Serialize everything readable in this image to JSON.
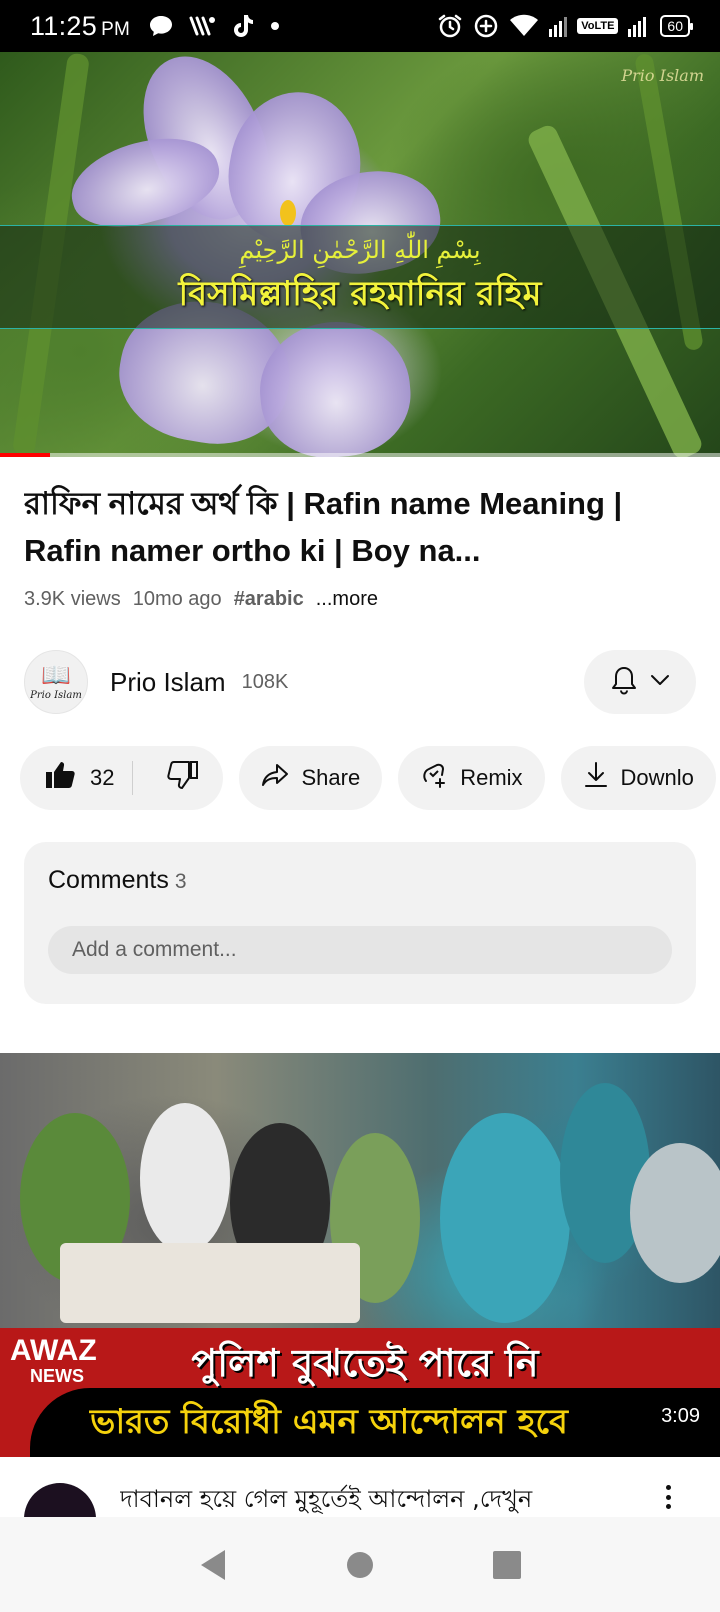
{
  "status_bar": {
    "time": "11:25",
    "ampm": "PM",
    "volte": "VoLTE",
    "battery": "60",
    "icons": [
      "chat-bubble-icon",
      "wifi-calling-icon",
      "tiktok-icon",
      "dot-icon",
      "alarm-icon",
      "data-saver-icon",
      "wifi-icon",
      "signal-icon",
      "signal-icon-2",
      "battery-icon"
    ]
  },
  "player": {
    "arabic_text": "بِسْمِ اللّٰهِ الرَّحْمٰنِ الرَّحِيْمِ",
    "bengali_text": "বিসমিল্লাহির রহমানির রহিম",
    "watermark": "Prio Islam",
    "progress_percent": 7
  },
  "video": {
    "title": "রাফিন নামের অর্থ কি | Rafin name Meaning | Rafin namer ortho ki | Boy na...",
    "views": "3.9K views",
    "age": "10mo ago",
    "hashtag": "#arabic",
    "more": "...more"
  },
  "channel": {
    "avatar_text": "Prio Islam",
    "name": "Prio Islam",
    "subscribers": "108K"
  },
  "actions": {
    "likes": "32",
    "share": "Share",
    "remix": "Remix",
    "download": "Downlo"
  },
  "comments": {
    "label": "Comments",
    "count": "3",
    "placeholder": "Add a comment..."
  },
  "next_video": {
    "logo_main": "AWAZ",
    "logo_sub": "NEWS",
    "banner_line1": "পুলিশ বুঝতেই পারে নি",
    "banner_line2": "ভারত বিরোধী এমন আন্দোলন হবে",
    "duration": "3:09",
    "title": "দাবানল হয়ে গেল মুহূর্তেই আন্দোলন ,দেখুন"
  },
  "colors": {
    "progress": "#ff0000",
    "pill_bg": "#f2f2f2",
    "banner_red": "#b81818",
    "banner_yellow": "#f5d20c"
  }
}
